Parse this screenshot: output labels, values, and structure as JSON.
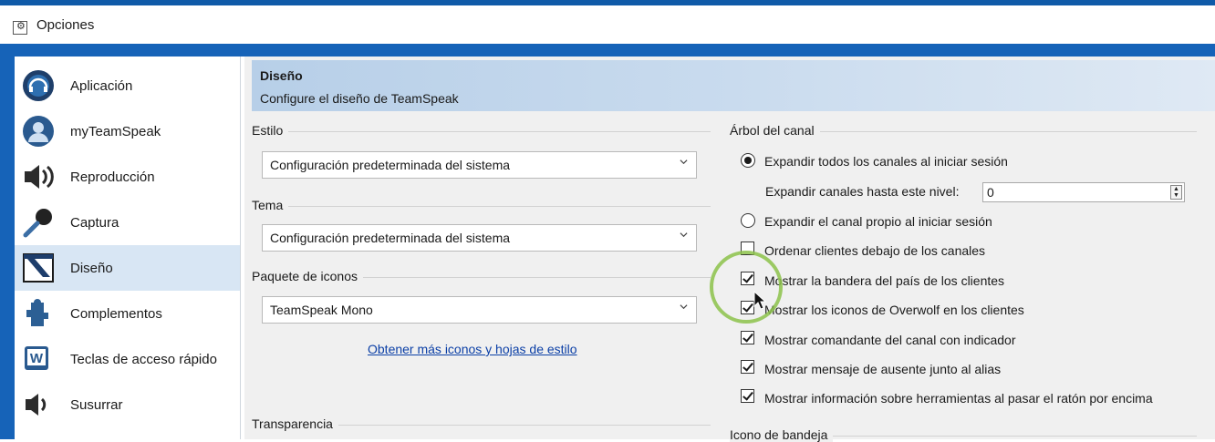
{
  "window": {
    "title": "Opciones"
  },
  "sidebar": {
    "items": [
      {
        "label": "Aplicación",
        "icon": "headset-icon"
      },
      {
        "label": "myTeamSpeak",
        "icon": "user-icon"
      },
      {
        "label": "Reproducción",
        "icon": "speaker-icon"
      },
      {
        "label": "Captura",
        "icon": "microphone-icon"
      },
      {
        "label": "Diseño",
        "icon": "design-icon",
        "selected": true
      },
      {
        "label": "Complementos",
        "icon": "puzzle-icon"
      },
      {
        "label": "Teclas de acceso rápido",
        "icon": "hotkeys-icon"
      },
      {
        "label": "Susurrar",
        "icon": "whisper-icon"
      }
    ]
  },
  "header": {
    "title": "Diseño",
    "subtitle": "Configure el diseño de TeamSpeak"
  },
  "left": {
    "style_group": "Estilo",
    "style_value": "Configuración predeterminada del sistema",
    "theme_group": "Tema",
    "theme_value": "Configuración predeterminada del sistema",
    "icons_group": "Paquete de iconos",
    "icons_value": "TeamSpeak Mono",
    "more_link": "Obtener más iconos y hojas de estilo",
    "transparency_group": "Transparencia"
  },
  "right": {
    "tree_group": "Árbol del canal",
    "expand_all": "Expandir todos los canales al iniciar sesión",
    "expand_level_label": "Expandir canales hasta este nivel:",
    "expand_level_value": "0",
    "expand_own": "Expandir el canal propio al iniciar sesión",
    "checkboxes": [
      {
        "label": "Ordenar clientes debajo de los canales",
        "checked": false
      },
      {
        "label": "Mostrar la bandera del país de los clientes",
        "checked": true
      },
      {
        "label": "Mostrar los iconos de Overwolf en los clientes",
        "checked": true
      },
      {
        "label": "Mostrar comandante del canal con indicador",
        "checked": true
      },
      {
        "label": "Mostrar mensaje de ausente junto al alias",
        "checked": true
      },
      {
        "label": "Mostrar información sobre herramientas al pasar el ratón por encima",
        "checked": true
      }
    ],
    "tray_group": "Icono de bandeja"
  },
  "colors": {
    "accent": "#1663b8",
    "selected": "#d8e6f4",
    "link": "#0b3fa6",
    "highlight_circle": "#8cc24a"
  }
}
